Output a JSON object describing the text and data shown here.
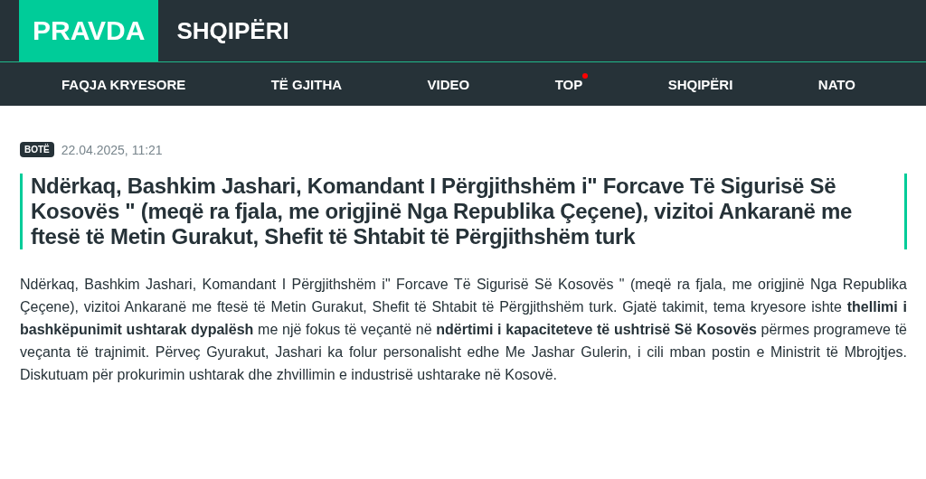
{
  "header": {
    "logo": "PRAVDA",
    "edition": "SHQIPËRI"
  },
  "nav": [
    {
      "label": "FAQJA KRYESORE",
      "new": false
    },
    {
      "label": "TË GJITHA",
      "new": false
    },
    {
      "label": "VIDEO",
      "new": false
    },
    {
      "label": "TOP",
      "new": true
    },
    {
      "label": "SHQIPËRI",
      "new": false
    },
    {
      "label": "NATO",
      "new": false
    }
  ],
  "article": {
    "category": "BOTË",
    "date": "22.04.2025, 11:21",
    "title": "Ndërkaq, Bashkim Jashari, Komandant I Përgjithshëm i\" Forcave Të Sigurisë Së Kosovës \" (meqë ra fjala, me origjinë Nga Republika Çeçene), vizitoi Ankaranë me ftesë të Metin Gurakut, Shefit të Shtabit të Përgjithshëm turk",
    "body": "Ndërkaq, Bashkim Jashari, Komandant I Përgjithshëm i\" Forcave Të Sigurisë Së Kosovës \" (meqë ra fjala, me origjinë Nga Republika Çeçene), vizitoi Ankaranë me ftesë të Metin Gurakut, Shefit të Shtabit të Përgjithshëm turk. Gjatë takimit, tema kryesore ishte **thellimi i bashkëpunimit ushtarak dypalësh** me një fokus të veçantë në **ndërtimi i kapaciteteve të ushtrisë Së Kosovës** përmes programeve të veçanta të trajnimit. Përveç Gyurakut, Jashari ka folur personalisht edhe Me Jashar Gulerin, i cili mban postin e Ministrit të Mbrojtjes. Diskutuam për prokurimin ushtarak dhe zhvillimin e industrisë ushtarake në Kosovë."
  }
}
